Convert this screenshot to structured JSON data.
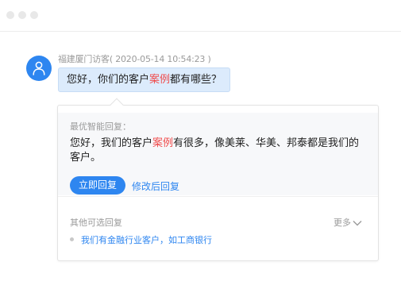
{
  "window": {
    "controls": [
      "close",
      "minimize",
      "maximize"
    ]
  },
  "message": {
    "sender": "福建厦门访客",
    "timestamp": "( 2020-05-14 10:54:23 )",
    "text_before": "您好，你们的客户",
    "keyword": "案例",
    "text_after": "都有哪些？",
    "avatar_icon": "user-icon"
  },
  "recommendation": {
    "label": "最优智能回复：",
    "text_before": "您好，我们的客户",
    "keyword": "案例",
    "text_after": "有很多，像美莱、华美、邦泰都是我们的客户。",
    "reply_button": "立即回复",
    "edit_link": "修改后回复"
  },
  "alternatives": {
    "label": "其他可选回复",
    "more_label": "更多",
    "items": [
      "我们有金融行业客户，如工商银行"
    ]
  },
  "colors": {
    "accent": "#2e86f0",
    "keyword": "#f04a4a",
    "bubble": "#dcebfc"
  }
}
